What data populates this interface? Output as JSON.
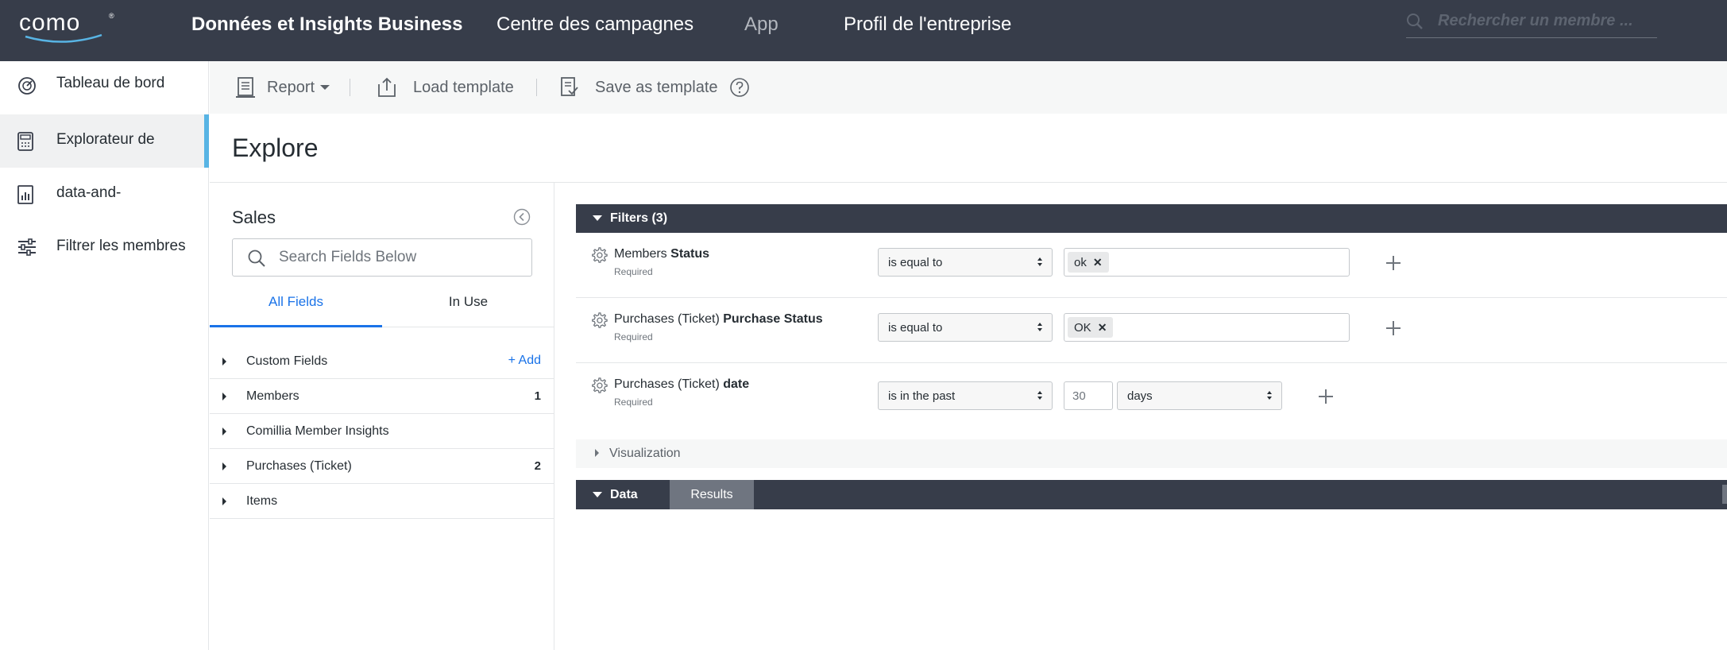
{
  "topbar": {
    "logo": "como",
    "logo_mark": "®",
    "nav": [
      {
        "label": "Données et Insights Business"
      },
      {
        "label": "Centre des campagnes"
      },
      {
        "label": "App"
      },
      {
        "label": "Profil de l'entreprise"
      }
    ],
    "search_placeholder": "Rechercher un membre ..."
  },
  "sidebar": {
    "items": [
      {
        "label": "Tableau de bord",
        "icon": "dashboard-icon"
      },
      {
        "label": "Explorateur de",
        "icon": "calculator-icon",
        "active": true
      },
      {
        "label": "data-and-",
        "icon": "bar-chart-icon"
      },
      {
        "label": "Filtrer les membres",
        "icon": "sliders-icon"
      }
    ]
  },
  "toolbar": {
    "report_label": "Report",
    "load_label": "Load template",
    "save_label": "Save as template",
    "help_icon": "question-circle-icon"
  },
  "page": {
    "title": "Explore"
  },
  "picker": {
    "title": "Sales",
    "search_placeholder": "Search Fields Below",
    "tabs": [
      {
        "label": "All Fields",
        "active": true
      },
      {
        "label": "In Use",
        "active": false
      }
    ],
    "rows": [
      {
        "label": "Custom Fields",
        "count": "",
        "add": "Add"
      },
      {
        "label": "Members",
        "count": "1",
        "add": ""
      },
      {
        "label": "Comillia Member Insights",
        "count": "",
        "add": ""
      },
      {
        "label": "Purchases (Ticket)",
        "count": "2",
        "add": ""
      },
      {
        "label": "Items",
        "count": "",
        "add": ""
      }
    ]
  },
  "filters": {
    "header": "Filters (3)",
    "rows": [
      {
        "prefix": "Members",
        "name": "Status",
        "required": "Required",
        "operator": "is equal to",
        "tag": "ok"
      },
      {
        "prefix": "Purchases (Ticket)",
        "name": "Purchase Status",
        "required": "Required",
        "operator": "is equal to",
        "tag": "OK"
      },
      {
        "prefix": "Purchases (Ticket)",
        "name": "date",
        "required": "Required",
        "operator": "is in the past",
        "number": "30",
        "unit": "days"
      }
    ]
  },
  "visualization": {
    "label": "Visualization"
  },
  "data_section": {
    "label": "Data",
    "results_label": "Results"
  },
  "colors": {
    "topbar": "#373d4a",
    "accent_blue": "#1a73e8",
    "active_indicator": "#58b4e4"
  }
}
